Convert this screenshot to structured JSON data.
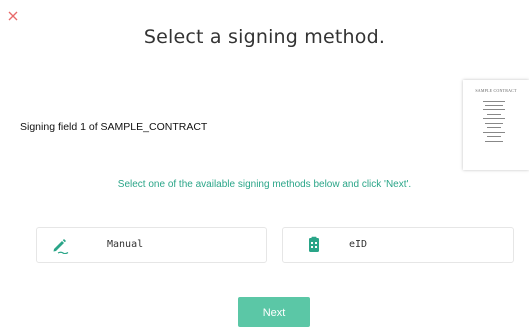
{
  "dialog": {
    "title": "Select a signing method.",
    "close_icon": "close-icon"
  },
  "document": {
    "field_label": "Signing field 1 of SAMPLE_CONTRACT",
    "thumbnail_title": "SAMPLE CONTRACT"
  },
  "instruction": "Select one of the available signing methods below and click 'Next'.",
  "methods": [
    {
      "label": "Manual",
      "icon": "pen-signature-icon"
    },
    {
      "label": "eID",
      "icon": "id-card-icon"
    }
  ],
  "next_label": "Next",
  "colors": {
    "accent": "#2aa588",
    "button": "#5bc7a6",
    "close": "#e86a6a"
  }
}
